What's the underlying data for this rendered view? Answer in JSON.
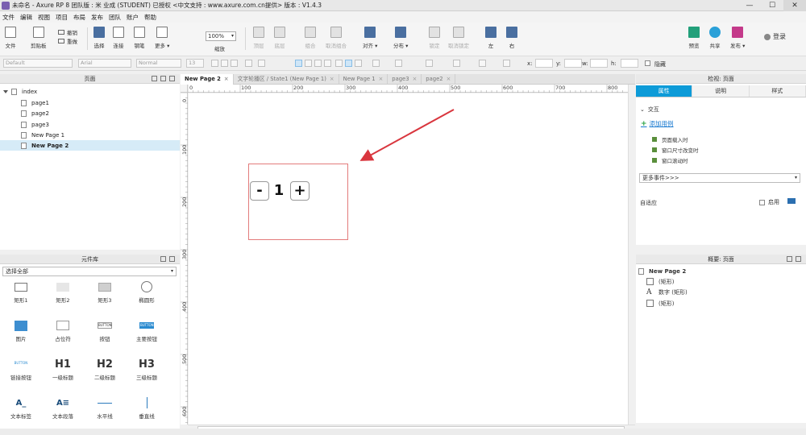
{
  "window": {
    "title": "未命名 - Axure RP 8 团队版 : 米 业成 (STUDENT) 已授权     <中文支持 : www.axure.com.cn提供> 版本 : V1.4.3",
    "min": "—",
    "max": "☐",
    "close": "✕"
  },
  "menu": [
    "文件",
    "编辑",
    "视图",
    "项目",
    "布局",
    "发布",
    "团队",
    "账户",
    "帮助"
  ],
  "toolbar": {
    "file": "文件",
    "clipboard": "剪贴板",
    "undo": "撤销",
    "redo": "重做",
    "select": "选择",
    "connect": "连接",
    "pen": "钢笔",
    "more": "更多 ▾",
    "zoom_value": "100%",
    "zoom_label": "缩放",
    "top_layer": "顶层",
    "bottom_layer": "底层",
    "group": "组合",
    "ungroup": "取消组合",
    "align": "对齐 ▾",
    "distribute": "分布 ▾",
    "lock": "锁定",
    "unlock": "取消锁定",
    "left": "左",
    "right": "右",
    "preview": "预览",
    "share": "共享",
    "publish": "发布 ▾",
    "login": "登录"
  },
  "format": {
    "style": "Default",
    "font": "Arial",
    "weight": "Normal",
    "size": "13",
    "x_label": "x:",
    "y_label": "y:",
    "w_label": "w:",
    "h_label": "h:",
    "hide_label": "隐藏"
  },
  "pages": {
    "title": "页面",
    "items": [
      {
        "label": "index"
      },
      {
        "label": "page1"
      },
      {
        "label": "page2"
      },
      {
        "label": "page3"
      },
      {
        "label": "New Page 1"
      },
      {
        "label": "New Page 2"
      }
    ]
  },
  "library": {
    "title": "元件库",
    "filter": "选择全部",
    "widgets": [
      {
        "label": "矩形1"
      },
      {
        "label": "矩形2"
      },
      {
        "label": "矩形3"
      },
      {
        "label": "椭圆形"
      },
      {
        "label": "图片"
      },
      {
        "label": "占位符"
      },
      {
        "label": "按钮"
      },
      {
        "label": "主要按钮"
      },
      {
        "label": "链接按钮"
      },
      {
        "label": "一级标题"
      },
      {
        "label": "二级标题"
      },
      {
        "label": "三级标题"
      },
      {
        "label": "文本标签"
      },
      {
        "label": "文本段落"
      },
      {
        "label": "水平线"
      },
      {
        "label": "垂直线"
      }
    ],
    "icon_text": {
      "button": "BUTTON",
      "h1": "H1",
      "h2": "H2",
      "h3": "H3",
      "text_label": "A_",
      "text_para": "A≡"
    }
  },
  "tabs": [
    {
      "label": "New Page 2"
    },
    {
      "label": "文字轮播区 / State1 (New Page 1)"
    },
    {
      "label": "New Page 1"
    },
    {
      "label": "page3"
    },
    {
      "label": "page2"
    }
  ],
  "ruler": {
    "h": [
      "0",
      "100",
      "200",
      "300",
      "400",
      "500",
      "600",
      "700",
      "800"
    ],
    "v": [
      "0",
      "100",
      "200",
      "300",
      "400",
      "500",
      "600"
    ]
  },
  "canvas": {
    "minus": "-",
    "value": "1",
    "plus": "+",
    "arrow_color": "#d9363e"
  },
  "inspector": {
    "title": "检视: 页面",
    "tabs": [
      "属性",
      "说明",
      "样式"
    ],
    "interaction": "交互",
    "add_case": "添加用例",
    "events": [
      "页面载入时",
      "窗口尺寸改变时",
      "窗口滚动时"
    ],
    "more_events": "更多事件>>>",
    "adaptive": "自适应",
    "enable": "启用"
  },
  "outline": {
    "title": "概要: 页面",
    "page": "New Page 2",
    "items": [
      {
        "label": "(矩形)",
        "type": "box"
      },
      {
        "label": "数字 (矩形)",
        "type": "text"
      },
      {
        "label": "(矩形)",
        "type": "box"
      }
    ]
  },
  "colors": {
    "accent": "#0d9bd8",
    "selection": "#e37b7b",
    "link": "#1a7ad0"
  }
}
